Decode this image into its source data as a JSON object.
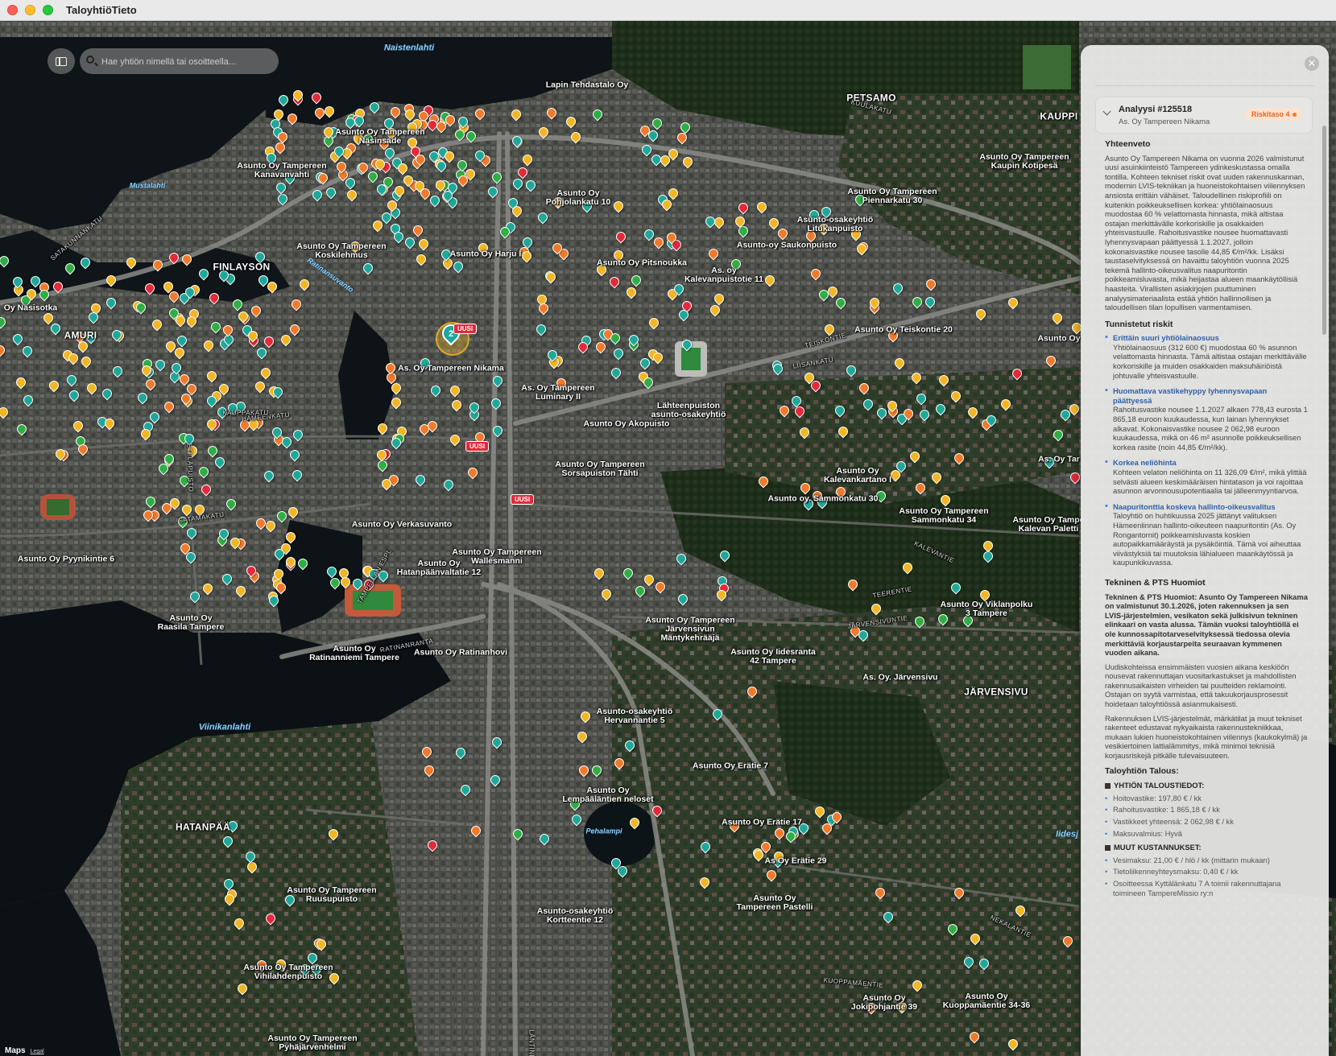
{
  "app": {
    "title": "TaloyhtiöTieto"
  },
  "search": {
    "placeholder": "Hae yhtiön nimellä tai osoitteella..."
  },
  "map": {
    "attribution": "Maps",
    "legal": "Legal",
    "new_badge": "UUSI",
    "selected_cluster_count": "2",
    "districts": [
      "FINLAYSON",
      "AMURI",
      "PETSAMO",
      "KAUPPI",
      "HATANPÄÄ",
      "JÄRVENSIVU"
    ],
    "water_labels": [
      "Naistenlahti",
      "Mustalahti",
      "Ratinansuvanto",
      "Viinikanlahti",
      "Pehalampi",
      "Iidesj"
    ],
    "street_labels": [
      "SATAKUNNANKATU",
      "HÄMEENKATU",
      "KAUPPAKATU",
      "TEISKONTIE",
      "KALEVANTIE",
      "LIISANKATU",
      "SATAMAKATU",
      "ETELÄPUISTO",
      "KUOPPAMÄENTIE",
      "NEKALANTIE",
      "TAMPELLAN ESPL",
      "LÄNTINEN",
      "RATINANRANTA",
      "TEERENTIE",
      "JÄRVENSIVUNTIE",
      "KUULAKATU"
    ],
    "place_labels": [
      "Lapin Tehdastalo Oy",
      "Asunto Oy Tampereen\nNäsinsäde",
      "Asunto Oy Tampereen\nKanavanvahti",
      "Asunto Oy\nPohjolankatu 10",
      "Asunto Oy Tampereen\nPiennarkatu 30",
      "Asunto Oy Tampereen\nKaupin Kotipesä",
      "Asunto Oy Tampereen\nKoskilehmus",
      "Asunto Oy Harju I",
      "Asunto Oy Pitsnoukka",
      "Asunto-osakeyhtiö\nLitukanpuisto",
      "Asunto-oy Saukonpuisto",
      "As. oy\nKalevanpuistotie 11",
      "Oy Näsisotka",
      "As. Oy Tampereen Nikama",
      "As. Oy Tampereen\nLuminary II",
      "Lähteenpuiston\nasunto-osakeyhtiö",
      "Asunto Oy Teiskontie 20",
      "Asunto Oy Akopuisto",
      "Asunto Oy Tampereen\nSorsapuiston Tähti",
      "Asunto Oy\nKalevankartano I",
      "Asunto oy. Sammonkatu 30",
      "Asunto Oy Tampereen\nSammonkatu 34",
      "Asunto Oy Tampe\nKalevan Paletti",
      "Asunto Oy Pyynikintie 6",
      "Asunto Oy Verkasuvanto",
      "Asunto Oy Tampereen\nWallesmanni",
      "Asunto Oy\nHatanpäänvaltatie 12",
      "Asunto Oy\nRaasila Tampere",
      "Asunto Oy\nRatinanniemi Tampere",
      "Asunto Oy Ratinanhovi",
      "Asunto Oy Tampereen\nJärvensivun\nMäntykehrääjä",
      "Asunto Oy Iidesranta\n42 Tampere",
      "Asunto Oy Viklanpolku\n3 Tampere",
      "As. Oy. Järvensivu",
      "Asunto-osakeyhtiö\nHervannantie 5",
      "Asunto Oy Erätie 7",
      "Asunto Oy\nLempääläntien neloset",
      "Asunto Oy Erätie 17",
      "As Oy Erätie 29",
      "Asunto Oy\nTampereen Pastelli",
      "Asunto Oy Tampereen\nRuusupuisto",
      "Asunto-osakeyhtiö\nKortteentie 12",
      "Asunto Oy Tampereen\nVihilahdenpuisto",
      "Asunto Oy\nJokipohjantie 39",
      "Asunto Oy\nKuoppamäentie 34-36",
      "Asunto Oy Tampereen\nPyhäjärvenhelmi",
      "As. Oy Tar",
      "Asunto Oy"
    ]
  },
  "panel": {
    "analysis_id": "Analyysi #125518",
    "analysis_name": "As. Oy Tampereen Nikama",
    "risk_badge": "Riskitaso 4",
    "summary_title": "Yhteenveto",
    "summary_text": "Asunto Oy Tampereen Nikama on vuonna 2026 valmistunut uusi asuinkiinteistö Tampereen ydinkeskustassa omalla tontilla. Kohteen tekniset riskit ovat uuden rakennuskannan, modernin LVIS-tekniikan ja huoneistokohtaisen viilennyksen ansiosta erittäin vähäiset. Taloudellinen riskiprofiili on kuitenkin poikkeuksellisen korkea: yhtiölainaosuus muodostaa 60 % velattomasta hinnasta, mikä altistaa ostajan merkittävälle korkoriskille ja osakkaiden yhteisvastuulle. Rahoitusvastike nousee huomattavasti lyhennysvapaan päättyessä 1.1.2027, jolloin kokonaisvastike nousee tasolle 44,85 €/m²/kk. Lisäksi taustaselvityksessä on havaittu taloyhtiön vuonna 2025 tekemä hallinto-oikeusvalitus naapuritontin poikkeamisluvasta, mikä heijastaa alueen maankäytöllisiä haasteita. Virallisten asiakirjojen puuttuminen analyysimateriaalista estää yhtiön hallinnollisen ja taloudellisen tilan lopullisen varmentamisen.",
    "risks_title": "Tunnistetut riskit",
    "risks": [
      {
        "title": "Erittäin suuri yhtiölainaosuus",
        "text": "Yhtiölainaosuus (312 600 €) muodostaa 60 % asunnon velattomasta hinnasta. Tämä altistaa ostajan merkittävälle korkoriskille ja muiden osakkaiden maksuhäiriöistä johtuvalle yhteisvastuulle."
      },
      {
        "title": "Huomattava vastikehyppy lyhennysvapaan päättyessä",
        "text": "Rahoitusvastike nousee 1.1.2027 alkaen 778,43 eurosta 1 865,18 euroon kuukaudessa, kun lainan lyhennykset alkavat. Kokonaisvastike nousee 2 062,98 euroon kuukaudessa, mikä on 46 m² asunnolle poikkeuksellisen korkea rasite (noin 44,85 €/m²/kk)."
      },
      {
        "title": "Korkea neliöhinta",
        "text": "Kohteen velaton neliöhinta on 11 326,09 €/m², mikä ylittää selvästi alueen keskimääräisen hintatason ja voi rajoittaa asunnon arvonnousupotentiaalia tai jälleenmyyntiarvoa."
      },
      {
        "title": "Naapuritonttia koskeva hallinto-oikeusvalitus",
        "text": "Taloyhtiö on huhtikuussa 2025 jättänyt valituksen Hämeenlinnan hallinto-oikeuteen naapuritontin (As. Oy Rongantornit) poikkeamisluvasta koskien autopaikkamääräystä ja pysäköintiä. Tämä voi aiheuttaa viivästyksiä tai muutoksia lähialueen maankäytössä ja kaupunkikuvassa."
      }
    ],
    "tech_title": "Tekninen & PTS Huomiot",
    "tech_bold": "Tekninen & PTS Huomiot: Asunto Oy Tampereen Nikama on valmistunut 30.1.2026, joten rakennuksen ja sen LVIS-järjestelmien, vesikaton sekä julkisivun tekninen elinkaari on vasta alussa. Tämän vuoksi taloyhtiöllä ei ole kunnossapitotarveselvityksessä tiedossa olevia merkittäviä korjaustarpeita seuraavan kymmenen vuoden aikana.",
    "tech_p1": "Uudiskohteissa ensimmäisten vuosien aikana keskiöön nousevat rakennuttajan vuositarkastukset ja mahdollisten rakennusaikaisten virheiden tai puutteiden reklamointi. Ostajan on syytä varmistaa, että takuukorjausprosessit hoidetaan taloyhtiössä asianmukaisesti.",
    "tech_p2": "Rakennuksen LVIS-järjestelmät, märkätilat ja muut tekniset rakenteet edustavat nykyaikaista rakennustekniikkaa, mukaan lukien huoneistokohtainen viilennys (kaukokylmä) ja vesikiertoinen lattialämmitys, mikä minimoi teknisiä korjausriskejä pitkälle tulevaisuuteen.",
    "finance_title": "Taloyhtiön Talous:",
    "finance_heading1": "YHTIÖN TALOUSTIEDOT:",
    "finance_items1": [
      "Hoitovastike: 197,80 € / kk",
      "Rahoitusvastike: 1 865,18 € / kk",
      "Vastikkeet yhteensä: 2 062,98 € / kk",
      "Maksuvalmius: Hyvä"
    ],
    "finance_heading2": "MUUT KUSTANNUKSET:",
    "finance_items2": [
      "Vesimaksu: 21,00 € / hlö / kk (mittarin mukaan)",
      "Tietoliikenneyhteysmaksu: 0,40 € / kk",
      "Osoitteessa Kyttälänkatu 7 A toimii rakennuttajana toimineen TampereMissio ry:n"
    ]
  }
}
